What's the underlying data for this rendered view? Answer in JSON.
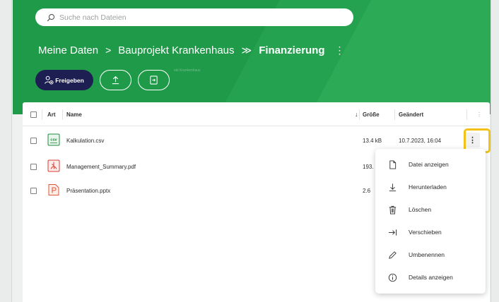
{
  "search": {
    "placeholder": "Suche nach Dateien"
  },
  "breadcrumb": {
    "root": "Meine Daten",
    "sep1": ">",
    "parent": "Bauprojekt Krankenhaus",
    "sep2": "≫",
    "current": "Finanzierung",
    "more": "⋮"
  },
  "actions": {
    "share_label": "Freigeben",
    "faint_text": "ekt Krankenhaus"
  },
  "table": {
    "headers": {
      "type": "Art",
      "name": "Name",
      "size": "Größe",
      "modified": "Geändert",
      "sort_arrow": "↓",
      "more": "⋮"
    },
    "rows": [
      {
        "name": "Kalkulation.csv",
        "size": "13.4 kB",
        "modified": "10.7.2023, 16:04",
        "icon": "csv-file-icon",
        "badge": "csv"
      },
      {
        "name": "Management_Summary.pdf",
        "size": "193.",
        "modified": "",
        "icon": "pdf-file-icon"
      },
      {
        "name": "Präsentation.pptx",
        "size": "2.6",
        "modified": "",
        "icon": "pptx-file-icon"
      }
    ],
    "row_menu": "⋮"
  },
  "context_menu": {
    "items": [
      {
        "label": "Datei anzeigen",
        "icon": "file-icon"
      },
      {
        "label": "Herunterladen",
        "icon": "download-icon"
      },
      {
        "label": "Löschen",
        "icon": "trash-icon"
      },
      {
        "label": "Verschieben",
        "icon": "move-icon"
      },
      {
        "label": "Umbenennen",
        "icon": "pencil-icon"
      },
      {
        "label": "Details anzeigen",
        "icon": "info-icon"
      }
    ]
  },
  "colors": {
    "brand_green": "#1f9a49",
    "share_button": "#1d1f52",
    "highlight": "#f2c316",
    "csv_green": "#1e8a3c",
    "pdf_red": "#d93b30",
    "pptx_red": "#e0553a"
  }
}
